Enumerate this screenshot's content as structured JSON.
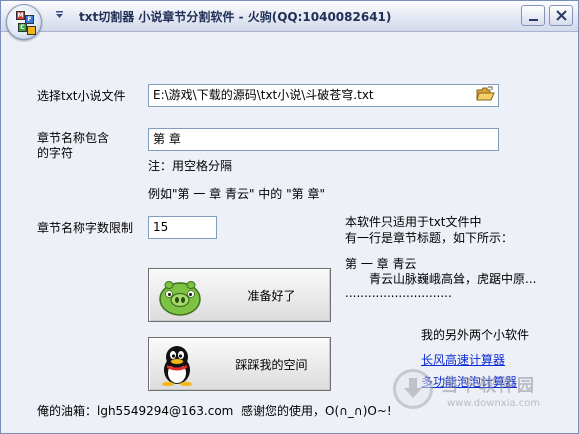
{
  "window": {
    "title": "txt切割器 小说章节分割软件 - 火驹(QQ:1040082641)"
  },
  "file": {
    "label": "选择txt小说文件",
    "value": "E:\\游戏\\下载的源码\\txt小说\\斗破苍穹.txt",
    "browse_icon": "folder-open-icon"
  },
  "chapter_name": {
    "label_line1": "章节名称包含",
    "label_line2": "的字符",
    "value": "第 章",
    "note": "注：用空格分隔",
    "example": "例如\"第 一 章   青云\" 中的 \"第  章\""
  },
  "limit": {
    "label": "章节名称字数限制",
    "value": "15"
  },
  "info": {
    "line1": "本软件只适用于txt文件中",
    "line2": "有一行是章节标题，如下所示：",
    "sample_title": "第 一 章   青云",
    "sample_body": "青云山脉巍峨高耸，虎踞中原...",
    "sample_dots": "............................"
  },
  "buttons": {
    "ready": "准备好了",
    "space": "踩踩我的空间"
  },
  "other_software": {
    "heading": "我的另外两个小软件",
    "link1": "长风高速计算器",
    "link2": "多功能泡泡计算器"
  },
  "footer": {
    "email": "俺的油箱：lgh5549294@163.com",
    "thanks": "感谢您的使用，O(∩_∩)O~!"
  },
  "watermark": {
    "title": "当下软件园",
    "subtitle": "www.downxia.com"
  }
}
